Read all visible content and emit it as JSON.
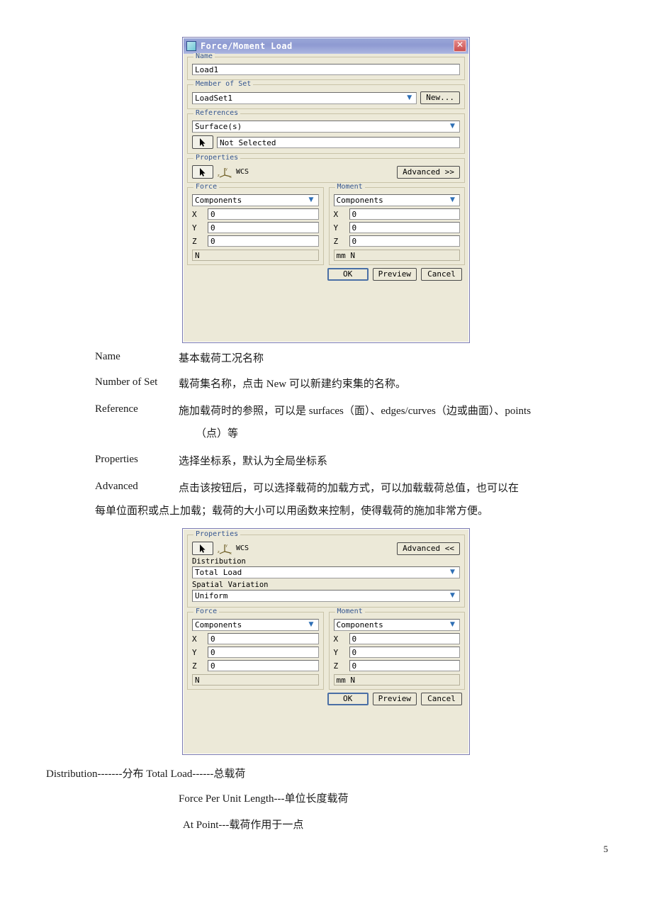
{
  "page": {
    "number": "5"
  },
  "dialog1": {
    "title": "Force/Moment  Load",
    "app_icon": "window-icon",
    "close_icon": "close-icon",
    "name_group": {
      "label": "Name",
      "value": "Load1"
    },
    "member_group": {
      "label": "Member of Set",
      "value": "LoadSet1",
      "new_button": "New..."
    },
    "references_group": {
      "label": "References",
      "type_value": "Surface(s)",
      "selection_value": "Not Selected"
    },
    "properties_group": {
      "label": "Properties",
      "csys_value": "WCS",
      "advanced_button": "Advanced >>"
    },
    "force": {
      "label": "Force",
      "mode": "Components",
      "x_label": "X",
      "x_value": "0",
      "y_label": "Y",
      "y_value": "0",
      "z_label": "Z",
      "z_value": "0",
      "unit": "N"
    },
    "moment": {
      "label": "Moment",
      "mode": "Components",
      "x_label": "X",
      "x_value": "0",
      "y_label": "Y",
      "y_value": "0",
      "z_label": "Z",
      "z_value": "0",
      "unit": "mm  N"
    },
    "buttons": {
      "ok": "OK",
      "preview": "Preview",
      "cancel": "Cancel"
    }
  },
  "dialog2": {
    "properties_group": {
      "label": "Properties",
      "csys_value": "WCS",
      "advanced_button": "Advanced <<",
      "distribution_label": "Distribution",
      "distribution_value": "Total Load",
      "spatial_label": "Spatial Variation",
      "spatial_value": "Uniform"
    },
    "force": {
      "label": "Force",
      "mode": "Components",
      "x_label": "X",
      "x_value": "0",
      "y_label": "Y",
      "y_value": "0",
      "z_label": "Z",
      "z_value": "0",
      "unit": "N"
    },
    "moment": {
      "label": "Moment",
      "mode": "Components",
      "x_label": "X",
      "x_value": "0",
      "y_label": "Y",
      "y_value": "0",
      "z_label": "Z",
      "z_value": "0",
      "unit": "mm  N"
    },
    "buttons": {
      "ok": "OK",
      "preview": "Preview",
      "cancel": "Cancel"
    }
  },
  "glossary": {
    "rows": [
      {
        "term": "Name",
        "def": "基本载荷工况名称"
      },
      {
        "term": "Number of Set",
        "def": "载荷集名称，点击 New 可以新建约束集的名称。"
      },
      {
        "term": "Reference",
        "def": "施加载荷时的参照，可以是 surfaces（面）、edges/curves（边或曲面）、points"
      },
      {
        "term": "",
        "def": "（点）等"
      },
      {
        "term": "Properties",
        "def": "选择坐标系，默认为全局坐标系"
      },
      {
        "term": "Advanced",
        "def": "点击该按钮后，可以选择载荷的加载方式，可以加载载荷总值，也可以在"
      }
    ],
    "continuation": "每单位面积或点上加载；载荷的大小可以用函数来控制，使得载荷的施加非常方便。"
  },
  "notes": {
    "line1": "Distribution-------分布  Total   Load------总载荷",
    "line2": "Force Per Unit   Length---单位长度载荷",
    "line3": "At   Point---载荷作用于一点"
  }
}
